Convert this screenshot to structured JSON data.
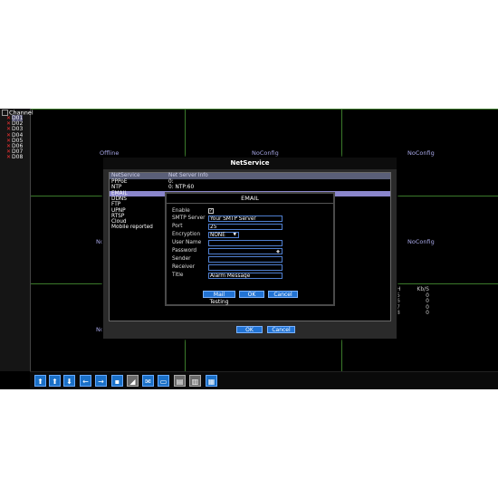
{
  "sidebar": {
    "title": "Channel",
    "channels": [
      {
        "label": "D01",
        "selected": true
      },
      {
        "label": "D02",
        "selected": false
      },
      {
        "label": "D03",
        "selected": false
      },
      {
        "label": "D04",
        "selected": false
      },
      {
        "label": "D05",
        "selected": false
      },
      {
        "label": "D06",
        "selected": false
      },
      {
        "label": "D07",
        "selected": false
      },
      {
        "label": "D08",
        "selected": false
      }
    ],
    "x_mark": "✕"
  },
  "cells": {
    "c1": "Offline",
    "c2": "NoConfig",
    "c3": "NoConfig",
    "c4": "No",
    "c5": "NoConfig",
    "c6": "No"
  },
  "stats": {
    "header": [
      "H",
      "Kb/S"
    ],
    "rows": [
      [
        "5",
        "0"
      ],
      [
        "6",
        "0"
      ],
      [
        "7",
        "0"
      ],
      [
        "8",
        "0"
      ]
    ]
  },
  "netservice": {
    "title": "NetService",
    "columns": [
      "NetService",
      "Net Server Info"
    ],
    "rows": [
      {
        "name": "PPPoE",
        "info": "0:"
      },
      {
        "name": "NTP",
        "info": "0: NTP:60"
      },
      {
        "name": "EMAIL",
        "info": "",
        "selected": true
      },
      {
        "name": "DDNS",
        "info": ""
      },
      {
        "name": "FTP",
        "info": ""
      },
      {
        "name": "UPNP",
        "info": ""
      },
      {
        "name": "RTSP",
        "info": ""
      },
      {
        "name": "Cloud",
        "info": ""
      },
      {
        "name": "Mobile reported",
        "info": ""
      }
    ],
    "ok_label": "OK",
    "cancel_label": "Cancel"
  },
  "email": {
    "title": "EMAIL",
    "enable_label": "Enable",
    "enable_checked": "✓",
    "smtp_label": "SMTP Server",
    "smtp_value": "Your SMTP Server",
    "port_label": "Port",
    "port_value": "25",
    "encryption_label": "Encryption",
    "encryption_value": "NONE",
    "username_label": "User Name",
    "username_value": "",
    "password_label": "Password",
    "password_value": "",
    "sender_label": "Sender",
    "sender_value": "",
    "receiver_label": "Receiver",
    "receiver_value": "",
    "title_label": "Title",
    "title_value": "Alarm Message",
    "mail_testing_label": "Mail Testing",
    "ok_label": "OK",
    "cancel_label": "Cancel"
  },
  "toolbar": {
    "buttons": [
      {
        "icon": "up-circle-icon",
        "glyph": "⬆"
      },
      {
        "icon": "up-circle-icon-2",
        "glyph": "⬆"
      },
      {
        "icon": "down-circle-icon",
        "glyph": "⬇"
      },
      {
        "icon": "arrow-left-icon",
        "glyph": "←"
      },
      {
        "icon": "arrow-right-icon",
        "glyph": "→"
      },
      {
        "icon": "record-icon",
        "glyph": "▪"
      },
      {
        "icon": "ptz-icon",
        "glyph": "◢"
      },
      {
        "icon": "mail-icon",
        "glyph": "✉"
      },
      {
        "icon": "monitor-icon",
        "glyph": "▭"
      },
      {
        "icon": "disk-icon",
        "glyph": "▤"
      },
      {
        "icon": "storage-icon",
        "glyph": "▥"
      },
      {
        "icon": "split-screen-icon",
        "glyph": "▦"
      }
    ]
  }
}
